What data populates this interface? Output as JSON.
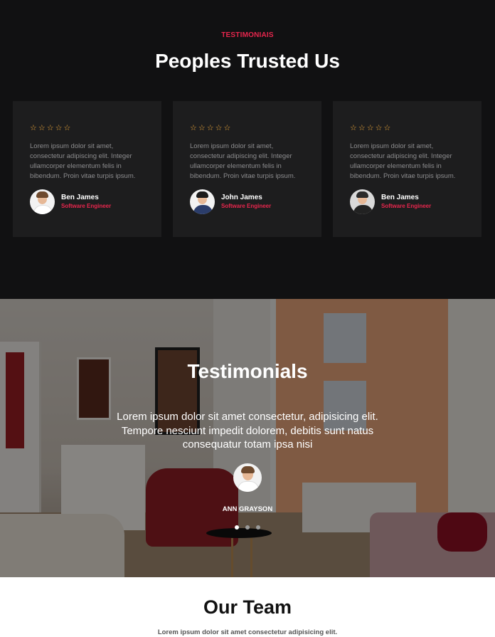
{
  "testimonials": {
    "eyebrow": "TESTIMONIAIS",
    "title": "Peoples Trusted Us",
    "star_color": "#f0a93a",
    "accent_color": "#e8264d",
    "rating_stars": 5,
    "cards": [
      {
        "text": "Lorem ipsum dolor sit amet, consectetur adipiscing elit. Integer ullamcorper elementum felis in bibendum. Proin vitae turpis ipsum.",
        "name": "Ben James",
        "role": "Software Engineer",
        "avatar": "user-avatar-icon"
      },
      {
        "text": "Lorem ipsum dolor sit amet, consectetur adipiscing elit. Integer ullamcorper elementum felis in bibendum. Proin vitae turpis ipsum.",
        "name": "John James",
        "role": "Software Engineer",
        "avatar": "user-avatar-icon"
      },
      {
        "text": "Lorem ipsum dolor sit amet, consectetur adipiscing elit. Integer ullamcorper elementum felis in bibendum. Proin vitae turpis ipsum.",
        "name": "Ben James",
        "role": "Software Engineer",
        "avatar": "user-avatar-icon"
      }
    ]
  },
  "slider": {
    "title": "Testimonials",
    "quote": "Lorem ipsum dolor sit amet consectetur, adipisicing elit. Tempore nesciunt impedit dolorem, debitis sunt natus consequatur totam ipsa nisi",
    "name": "ANN GRAYSON",
    "active_slide": 1,
    "slide_count": 3
  },
  "team": {
    "title": "Our Team",
    "subtitle": "Lorem ipsum dolor sit amet consectetur adipisicing elit."
  }
}
